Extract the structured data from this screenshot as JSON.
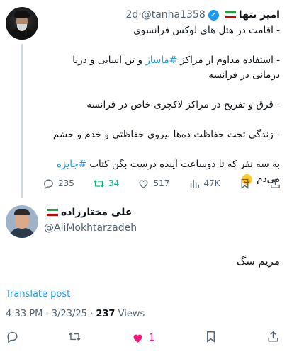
{
  "original_tweet": {
    "display_name": "امیر تنها",
    "handle": "@tanha1358",
    "time": "2d",
    "lines": [
      "- اقامت در هتل های لوکس فرانسوی",
      "",
      "- استفاده مداوم از مراکز #ماساژ و تن آسایی و دریا درمانی در فرانسه",
      "",
      "- قرق و تفریح در مراکز لاکچری خاص در فرانسه",
      "",
      "- زندگی تحت حفاظت ده‌ها نیروی حفاظتی و خدم و حشم",
      "",
      "به سه نفر که تا دوساعت آینده درست بگن کتاب #جایزه می‌دم"
    ],
    "line1": "- اقامت در هتل های لوکس فرانسوی",
    "line2_pre": "- استفاده مداوم از مراکز ",
    "line2_tag": "#ماساژ",
    "line2_post": " و تن آسایی و دریا درمانی در فرانسه",
    "line3": "- قرق و تفریح در مراکز لاکچری خاص در فرانسه",
    "line4": "- زندگی تحت حفاظت ده‌ها نیروی حفاظتی و خدم و حشم",
    "line5_pre": "به سه نفر که تا دوساعت آینده درست بگن کتاب ",
    "line5_tag": "#جایزه",
    "line5_post": " می‌دم",
    "stats": {
      "replies": "235",
      "retweets": "34",
      "likes": "517",
      "views": "47K"
    }
  },
  "reply": {
    "display_name": "علی مختارزاده",
    "handle": "@AliMokhtarzadeh",
    "text": "مریم سگ",
    "translate_label": "Translate post",
    "time": "4:33 PM",
    "date": "3/23/25",
    "views_count": "237",
    "views_label": "Views",
    "likes": "1"
  },
  "colors": {
    "accent": "#1d9bf0",
    "retweet": "#00ba7c",
    "like": "#f91880",
    "muted": "#536471"
  }
}
